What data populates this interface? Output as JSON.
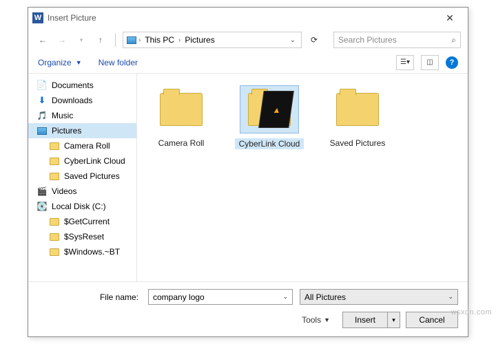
{
  "title": "Insert Picture",
  "breadcrumb": {
    "root": "This PC",
    "folder": "Pictures"
  },
  "search_placeholder": "Search Pictures",
  "toolbar": {
    "organize": "Organize",
    "new_folder": "New folder"
  },
  "tree": {
    "documents": "Documents",
    "downloads": "Downloads",
    "music": "Music",
    "pictures": "Pictures",
    "camera_roll": "Camera Roll",
    "cyberlink": "CyberLink Cloud",
    "saved_pictures": "Saved Pictures",
    "videos": "Videos",
    "local_disk": "Local Disk (C:)",
    "getcurrent": "$GetCurrent",
    "sysreset": "$SysReset",
    "windowsbt": "$Windows.~BT"
  },
  "items": {
    "camera_roll": "Camera Roll",
    "cyberlink": "CyberLink Cloud",
    "saved_pictures": "Saved Pictures"
  },
  "footer": {
    "file_name_label": "File name:",
    "file_name_value": "company logo",
    "filter": "All Pictures",
    "tools": "Tools",
    "insert": "Insert",
    "cancel": "Cancel"
  },
  "watermark": "wsxdn.com"
}
